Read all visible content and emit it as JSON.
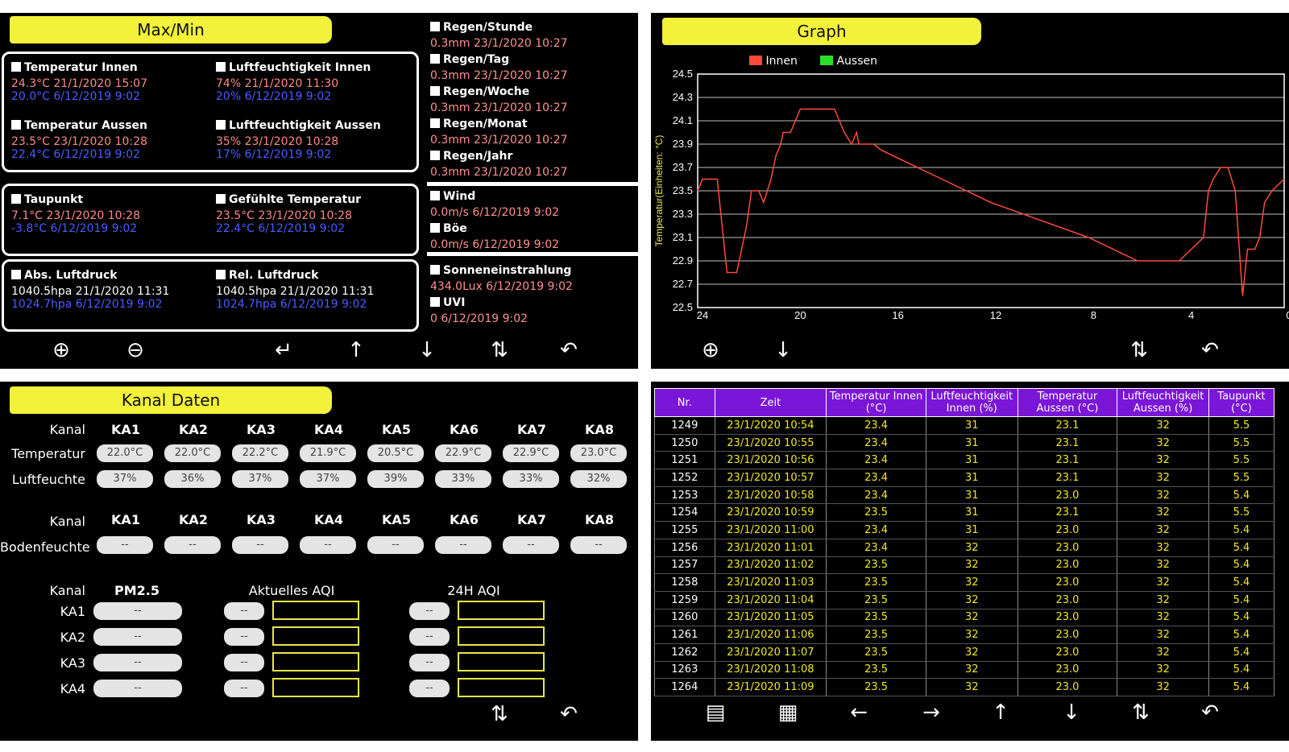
{
  "maxmin": {
    "title": "Max/Min",
    "temp_in": {
      "label": "Temperatur Innen",
      "max": "24.3°C 21/1/2020 15:07",
      "min": "20.0°C 6/12/2019 9:02"
    },
    "hum_in": {
      "label": "Luftfeuchtigkeit Innen",
      "max": "74% 21/1/2020 11:30",
      "min": "20% 6/12/2019 9:02"
    },
    "temp_out": {
      "label": "Temperatur Aussen",
      "max": "23.5°C 23/1/2020 10:28",
      "min": "22.4°C 6/12/2019 9:02"
    },
    "hum_out": {
      "label": "Luftfeuchtigkeit Aussen",
      "max": "35% 23/1/2020 10:28",
      "min": "17% 6/12/2019 9:02"
    },
    "dew": {
      "label": "Taupunkt",
      "max": "7.1°C 23/1/2020 10:28",
      "min": "-3.8°C 6/12/2019 9:02"
    },
    "feel": {
      "label": "Gefühlte Temperatur",
      "max": "23.5°C 23/1/2020 10:28",
      "min": "22.4°C 6/12/2019 9:02"
    },
    "abs": {
      "label": "Abs. Luftdruck",
      "max": "1040.5hpa 21/1/2020 11:31",
      "min": "1024.7hpa 6/12/2019 9:02"
    },
    "rel": {
      "label": "Rel. Luftdruck",
      "max": "1040.5hpa 21/1/2020 11:31",
      "min": "1024.7hpa 6/12/2019 9:02"
    },
    "rain_h": {
      "label": "Regen/Stunde",
      "val": "0.3mm 23/1/2020 10:27"
    },
    "rain_d": {
      "label": "Regen/Tag",
      "val": "0.3mm 23/1/2020 10:27"
    },
    "rain_w": {
      "label": "Regen/Woche",
      "val": "0.3mm 23/1/2020 10:27"
    },
    "rain_m": {
      "label": "Regen/Monat",
      "val": "0.3mm 23/1/2020 10:27"
    },
    "rain_y": {
      "label": "Regen/Jahr",
      "val": "0.3mm 23/1/2020 10:27"
    },
    "wind": {
      "label": "Wind",
      "val": "0.0m/s 6/12/2019 9:02"
    },
    "gust": {
      "label": "Böe",
      "val": "0.0m/s 6/12/2019 9:02"
    },
    "solar": {
      "label": "Sonneneinstrahlung",
      "val": "434.0Lux 6/12/2019 9:02"
    },
    "uvi": {
      "label": "UVI",
      "val": "0 6/12/2019 9:02"
    }
  },
  "graph": {
    "title": "Graph",
    "legend_in": "Innen",
    "legend_out": "Aussen",
    "color_in": "#ff4a3a",
    "color_out": "#2adf2a"
  },
  "chart_data": {
    "type": "line",
    "ylabel": "Temperatur(Einheiten: °C)",
    "ylim": [
      22.5,
      24.5
    ],
    "xlim": [
      24,
      0
    ],
    "yticks": [
      "24.5",
      "24.3",
      "24.1",
      "23.9",
      "23.7",
      "23.5",
      "23.3",
      "23.1",
      "22.9",
      "22.7",
      "22.5"
    ],
    "xticks": [
      "24",
      "20",
      "16",
      "12",
      "8",
      "4",
      "0"
    ],
    "series": [
      {
        "name": "Innen",
        "x": [
          24,
          23.8,
          23.6,
          23.2,
          23.1,
          22.8,
          22.4,
          22.0,
          21.8,
          21.5,
          21.3,
          21.0,
          20.8,
          20.6,
          20.5,
          20.3,
          20.2,
          20.0,
          19.8,
          19.5,
          19.3,
          18.4,
          18.2,
          18.0,
          17.7,
          17.5,
          17.4,
          17.2,
          17.0,
          16.8,
          16.5,
          15.5,
          14.0,
          12.0,
          10.0,
          8.0,
          6.0,
          4.3,
          3.3,
          3.1,
          2.9,
          2.6,
          2.3,
          2.0,
          1.7,
          1.5,
          1.2,
          1.0,
          0.8,
          0.5,
          0.0
        ],
        "y": [
          23.5,
          23.6,
          23.6,
          23.6,
          23.4,
          22.8,
          22.8,
          23.2,
          23.5,
          23.5,
          23.4,
          23.6,
          23.8,
          23.9,
          24.0,
          24.0,
          24.0,
          24.1,
          24.2,
          24.2,
          24.2,
          24.2,
          24.1,
          24.0,
          23.9,
          24.0,
          23.9,
          23.9,
          23.9,
          23.9,
          23.85,
          23.75,
          23.6,
          23.4,
          23.25,
          23.1,
          22.9,
          22.9,
          23.1,
          23.5,
          23.6,
          23.7,
          23.7,
          23.5,
          22.6,
          23.0,
          23.0,
          23.1,
          23.4,
          23.5,
          23.6
        ]
      }
    ]
  },
  "kanal": {
    "title": "Kanal Daten",
    "kanal_label": "Kanal",
    "channels": [
      "KA1",
      "KA2",
      "KA3",
      "KA4",
      "KA5",
      "KA6",
      "KA7",
      "KA8"
    ],
    "temp_label": "Temperatur",
    "temps": [
      "22.0°C",
      "22.0°C",
      "22.2°C",
      "21.9°C",
      "20.5°C",
      "22.9°C",
      "22.9°C",
      "23.0°C"
    ],
    "hum_label": "Luftfeuchte",
    "hums": [
      "37%",
      "36%",
      "37%",
      "37%",
      "39%",
      "33%",
      "33%",
      "32%"
    ],
    "soil_label": "Bodenfeuchte",
    "soil": [
      "--",
      "--",
      "--",
      "--",
      "--",
      "--",
      "--",
      "--"
    ],
    "pm_label": "PM2.5",
    "aqi_label": "Aktuelles AQI",
    "aqi24_label": "24H AQI",
    "pm_rows": [
      {
        "ch": "KA1",
        "pm": "--",
        "aqi": "--",
        "aqi24": "--"
      },
      {
        "ch": "KA2",
        "pm": "--",
        "aqi": "--",
        "aqi24": "--"
      },
      {
        "ch": "KA3",
        "pm": "--",
        "aqi": "--",
        "aqi24": "--"
      },
      {
        "ch": "KA4",
        "pm": "--",
        "aqi": "--",
        "aqi24": "--"
      }
    ]
  },
  "table": {
    "headers": [
      "Nr.",
      "Zeit",
      "Temperatur Innen (°C)",
      "Luftfeuchtigkeit Innen (%)",
      "Temperatur Aussen (°C)",
      "Luftfeuchtigkeit Aussen (%)",
      "Taupunkt (°C)"
    ],
    "rows": [
      [
        "1249",
        "23/1/2020 10:54",
        "23.4",
        "31",
        "23.1",
        "32",
        "5.5"
      ],
      [
        "1250",
        "23/1/2020 10:55",
        "23.4",
        "31",
        "23.1",
        "32",
        "5.5"
      ],
      [
        "1251",
        "23/1/2020 10:56",
        "23.4",
        "31",
        "23.1",
        "32",
        "5.5"
      ],
      [
        "1252",
        "23/1/2020 10:57",
        "23.4",
        "31",
        "23.1",
        "32",
        "5.5"
      ],
      [
        "1253",
        "23/1/2020 10:58",
        "23.4",
        "31",
        "23.0",
        "32",
        "5.4"
      ],
      [
        "1254",
        "23/1/2020 10:59",
        "23.5",
        "31",
        "23.1",
        "32",
        "5.5"
      ],
      [
        "1255",
        "23/1/2020 11:00",
        "23.4",
        "31",
        "23.0",
        "32",
        "5.4"
      ],
      [
        "1256",
        "23/1/2020 11:01",
        "23.4",
        "32",
        "23.0",
        "32",
        "5.4"
      ],
      [
        "1257",
        "23/1/2020 11:02",
        "23.5",
        "32",
        "23.0",
        "32",
        "5.4"
      ],
      [
        "1258",
        "23/1/2020 11:03",
        "23.5",
        "32",
        "23.0",
        "32",
        "5.4"
      ],
      [
        "1259",
        "23/1/2020 11:04",
        "23.5",
        "32",
        "23.0",
        "32",
        "5.4"
      ],
      [
        "1260",
        "23/1/2020 11:05",
        "23.5",
        "32",
        "23.0",
        "32",
        "5.4"
      ],
      [
        "1261",
        "23/1/2020 11:06",
        "23.5",
        "32",
        "23.0",
        "32",
        "5.4"
      ],
      [
        "1262",
        "23/1/2020 11:07",
        "23.5",
        "32",
        "23.0",
        "32",
        "5.4"
      ],
      [
        "1263",
        "23/1/2020 11:08",
        "23.5",
        "32",
        "23.0",
        "32",
        "5.4"
      ],
      [
        "1264",
        "23/1/2020 11:09",
        "23.5",
        "32",
        "23.0",
        "32",
        "5.4"
      ]
    ]
  },
  "icons": {
    "zoom_in": "⊕",
    "zoom_out": "⊖",
    "enter": "↵",
    "up": "↑",
    "down": "↓",
    "updown": "⇅",
    "back": "↶",
    "left": "←",
    "right": "→",
    "list": "▤",
    "calendar": "▦"
  }
}
